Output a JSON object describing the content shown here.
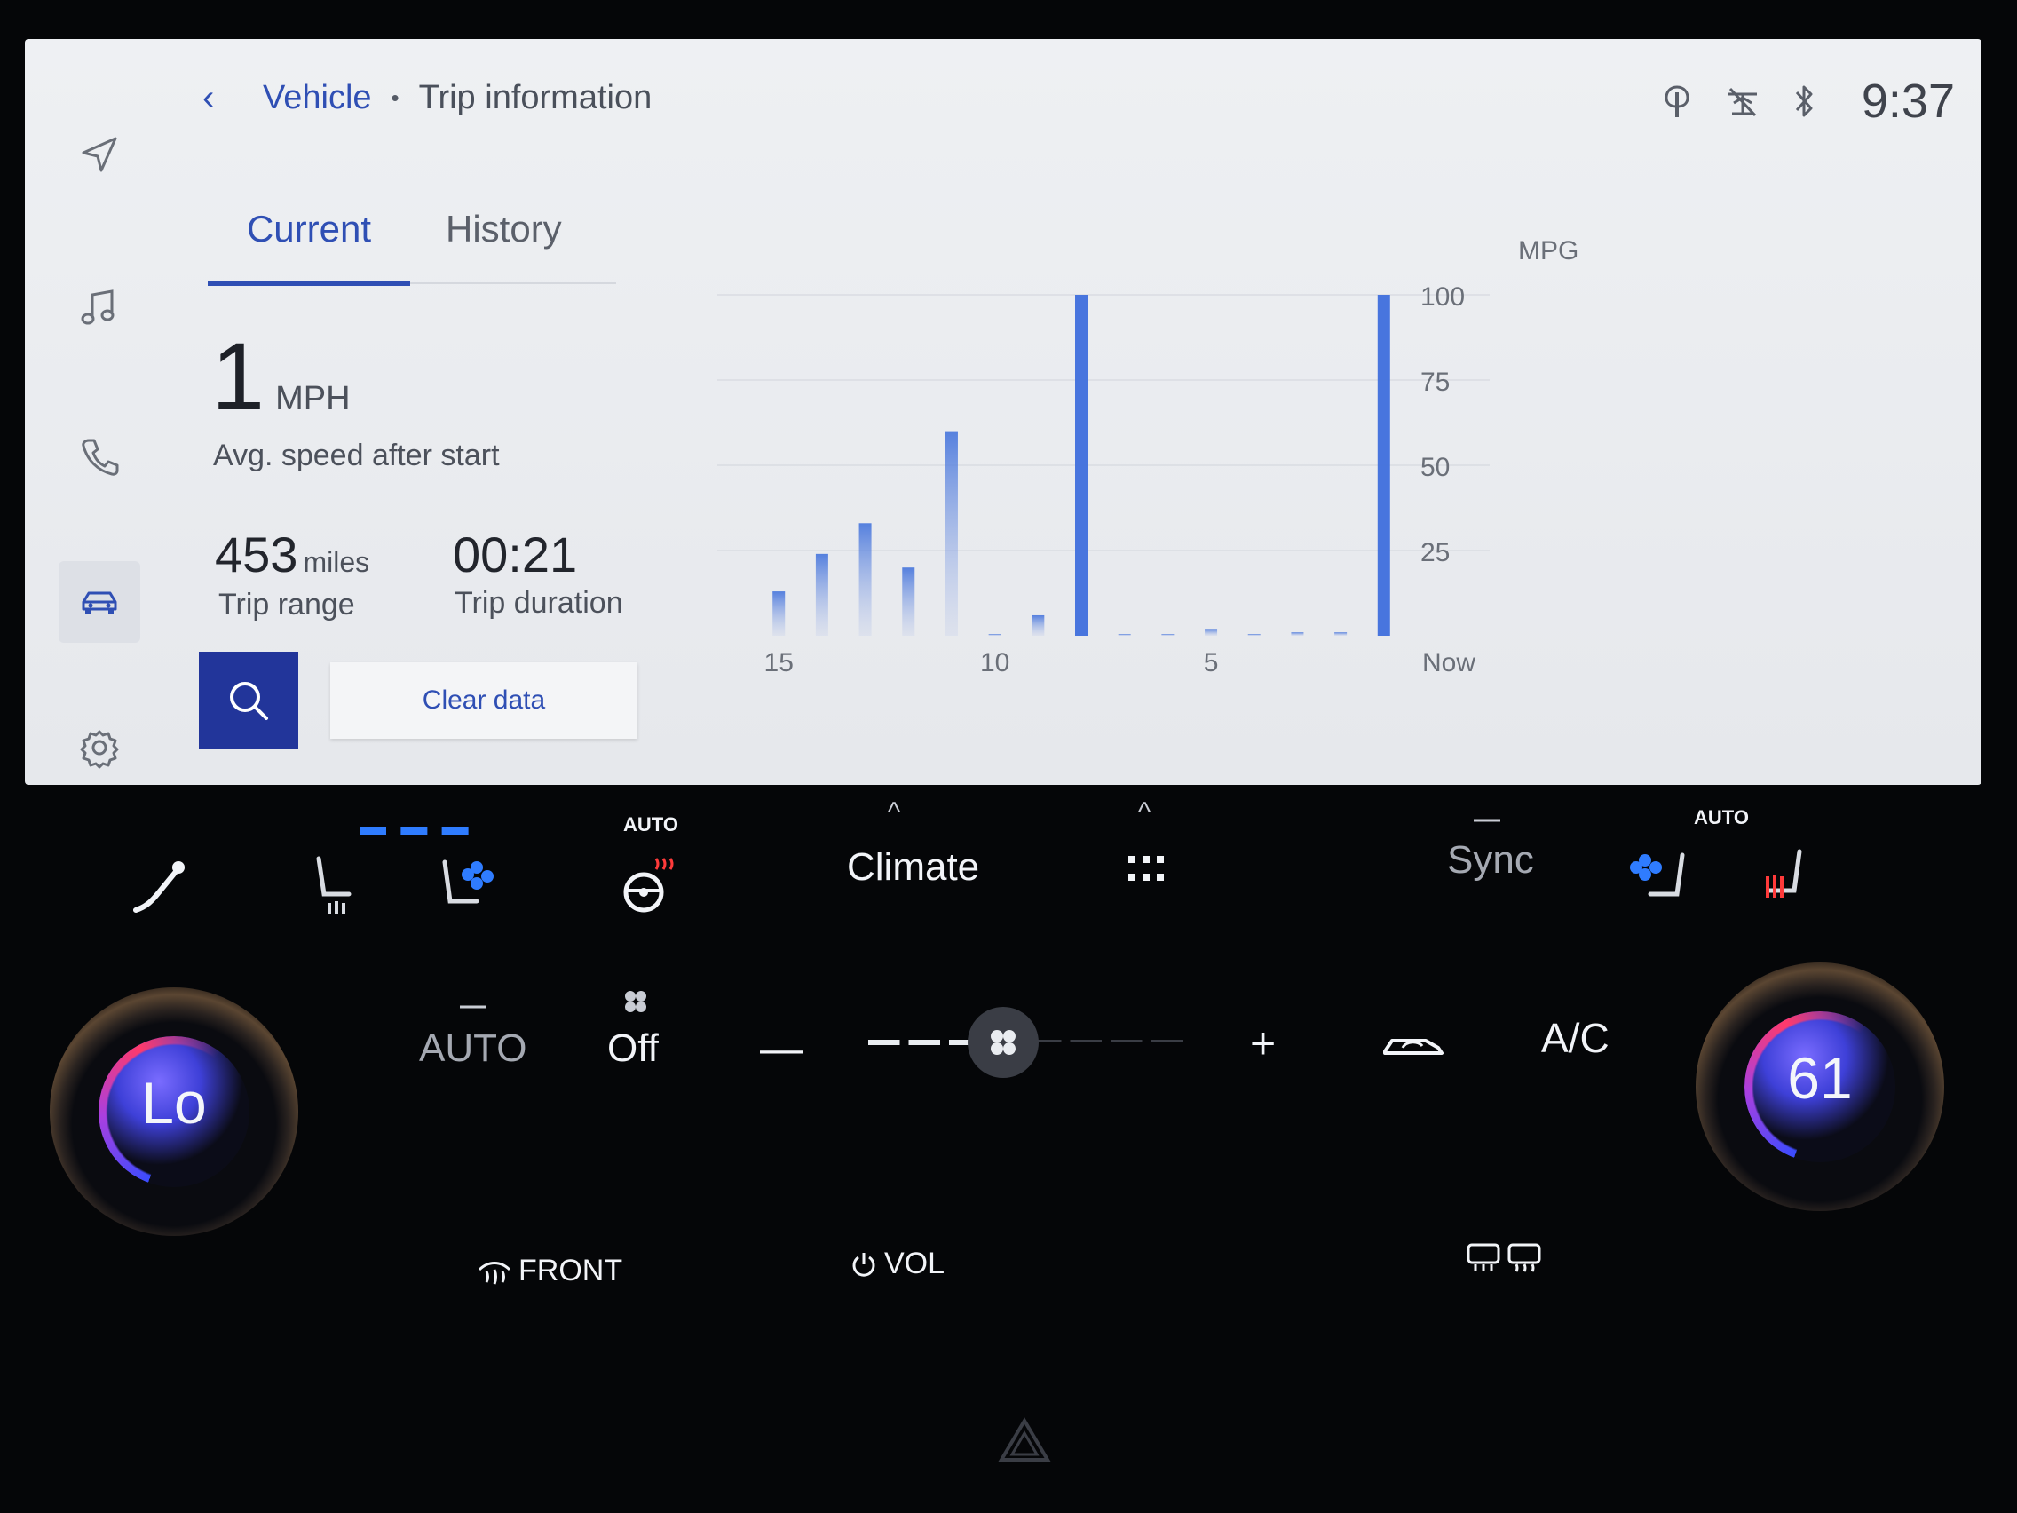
{
  "breadcrumb": {
    "back": "‹",
    "parent": "Vehicle",
    "separator": "•",
    "current": "Trip information"
  },
  "status": {
    "clock": "9:37",
    "icons": [
      "wireless-charging-icon",
      "signal-icon",
      "bluetooth-icon"
    ]
  },
  "rail": [
    "navigation-icon",
    "music-icon",
    "phone-icon",
    "car-icon",
    "gear-icon"
  ],
  "tabs": [
    {
      "label": "Current",
      "active": true
    },
    {
      "label": "History",
      "active": false
    }
  ],
  "stats": {
    "speed_value": "1",
    "speed_unit": "MPH",
    "speed_label": "Avg. speed after start",
    "range_value": "453",
    "range_unit": "miles",
    "range_label": "Trip range",
    "duration_value": "00:21",
    "duration_label": "Trip duration"
  },
  "actions": {
    "clear_label": "Clear data"
  },
  "chart_data": {
    "type": "bar",
    "ylabel": "MPG",
    "ylim": [
      0,
      100
    ],
    "yticks": [
      25,
      50,
      75,
      100
    ],
    "xtick_labels": [
      "15",
      "10",
      "5",
      "Now"
    ],
    "grid": true,
    "x": [
      15,
      14,
      13,
      12,
      11,
      10,
      9,
      8,
      7,
      6,
      5,
      4,
      3,
      2,
      1
    ],
    "values": [
      13,
      24,
      33,
      20,
      60,
      0,
      6,
      100,
      0,
      0,
      2,
      0,
      1,
      1,
      100
    ],
    "color": "#3f6fdc"
  },
  "climate": {
    "left_temp": "Lo",
    "right_temp": "61",
    "auto_top_left": "AUTO",
    "auto_top_right": "AUTO",
    "climate_label": "Climate",
    "sync_label": "Sync",
    "auto_label": "AUTO",
    "fan_state": "Off",
    "minus": "—",
    "plus": "+",
    "ac_label": "A/C",
    "front_label": "FRONT",
    "vol_label": "VOL",
    "fan_level": 0.4,
    "caret": "^",
    "dash": "—"
  }
}
